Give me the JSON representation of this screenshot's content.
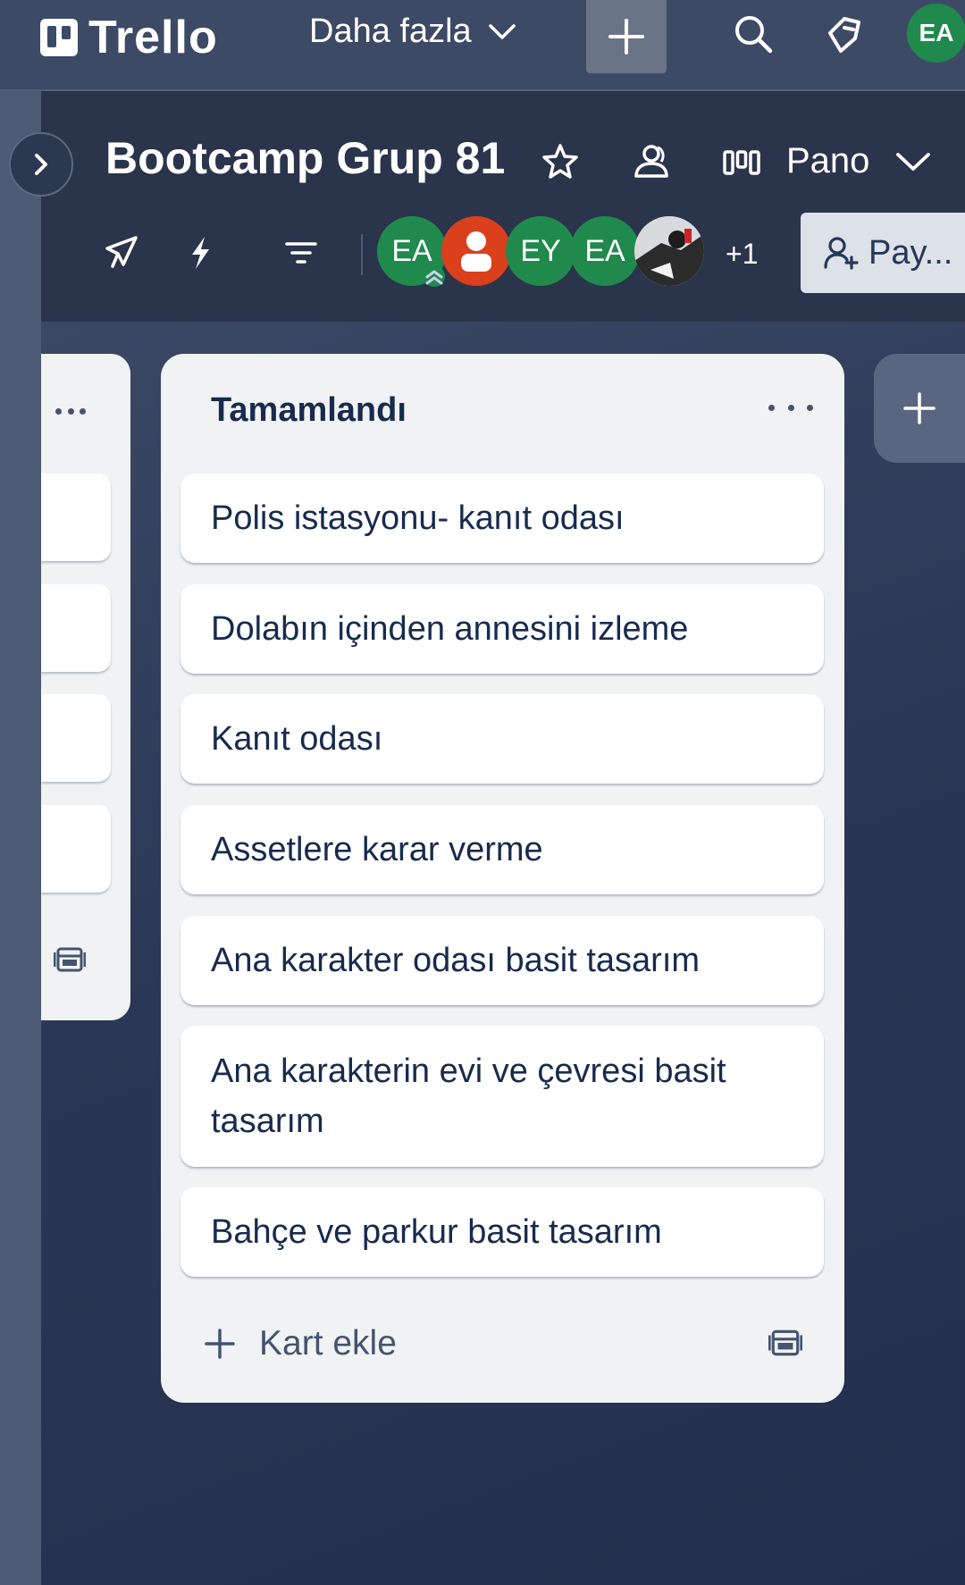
{
  "topbar": {
    "logo_text": "Trello",
    "more_label": "Daha fazla",
    "user_initials": "EA"
  },
  "board": {
    "title": "Bootcamp Grup 81",
    "view_label": "Pano",
    "members": [
      {
        "initials": "EA",
        "color": "#1f8a4c",
        "badge": true
      },
      {
        "initials": "",
        "color": "#d9401b",
        "placeholder": true
      },
      {
        "initials": "EY",
        "color": "#1f8a4c"
      },
      {
        "initials": "EA",
        "color": "#1f8a4c"
      },
      {
        "initials": "",
        "color": "#7a7a7a",
        "photo": true
      }
    ],
    "extra_members": "+1",
    "share_label": "Pay..."
  },
  "list": {
    "title": "Tamamlandı",
    "cards": [
      "Polis istasyonu- kanıt odası",
      "Dolabın içinden annesini izleme",
      "Kanıt odası",
      "Assetlere karar verme",
      "Ana karakter odası basit tasarım",
      "Ana karakterin evi ve çevresi basit tasarım",
      "Bahçe ve parkur basit tasarım"
    ],
    "add_card_label": "Kart ekle"
  },
  "colors": {
    "topbar": "#3d4a66",
    "header": "#2a344b",
    "list_bg": "#f1f2f4",
    "member_green": "#1f8a4c",
    "member_orange": "#d9401b"
  }
}
